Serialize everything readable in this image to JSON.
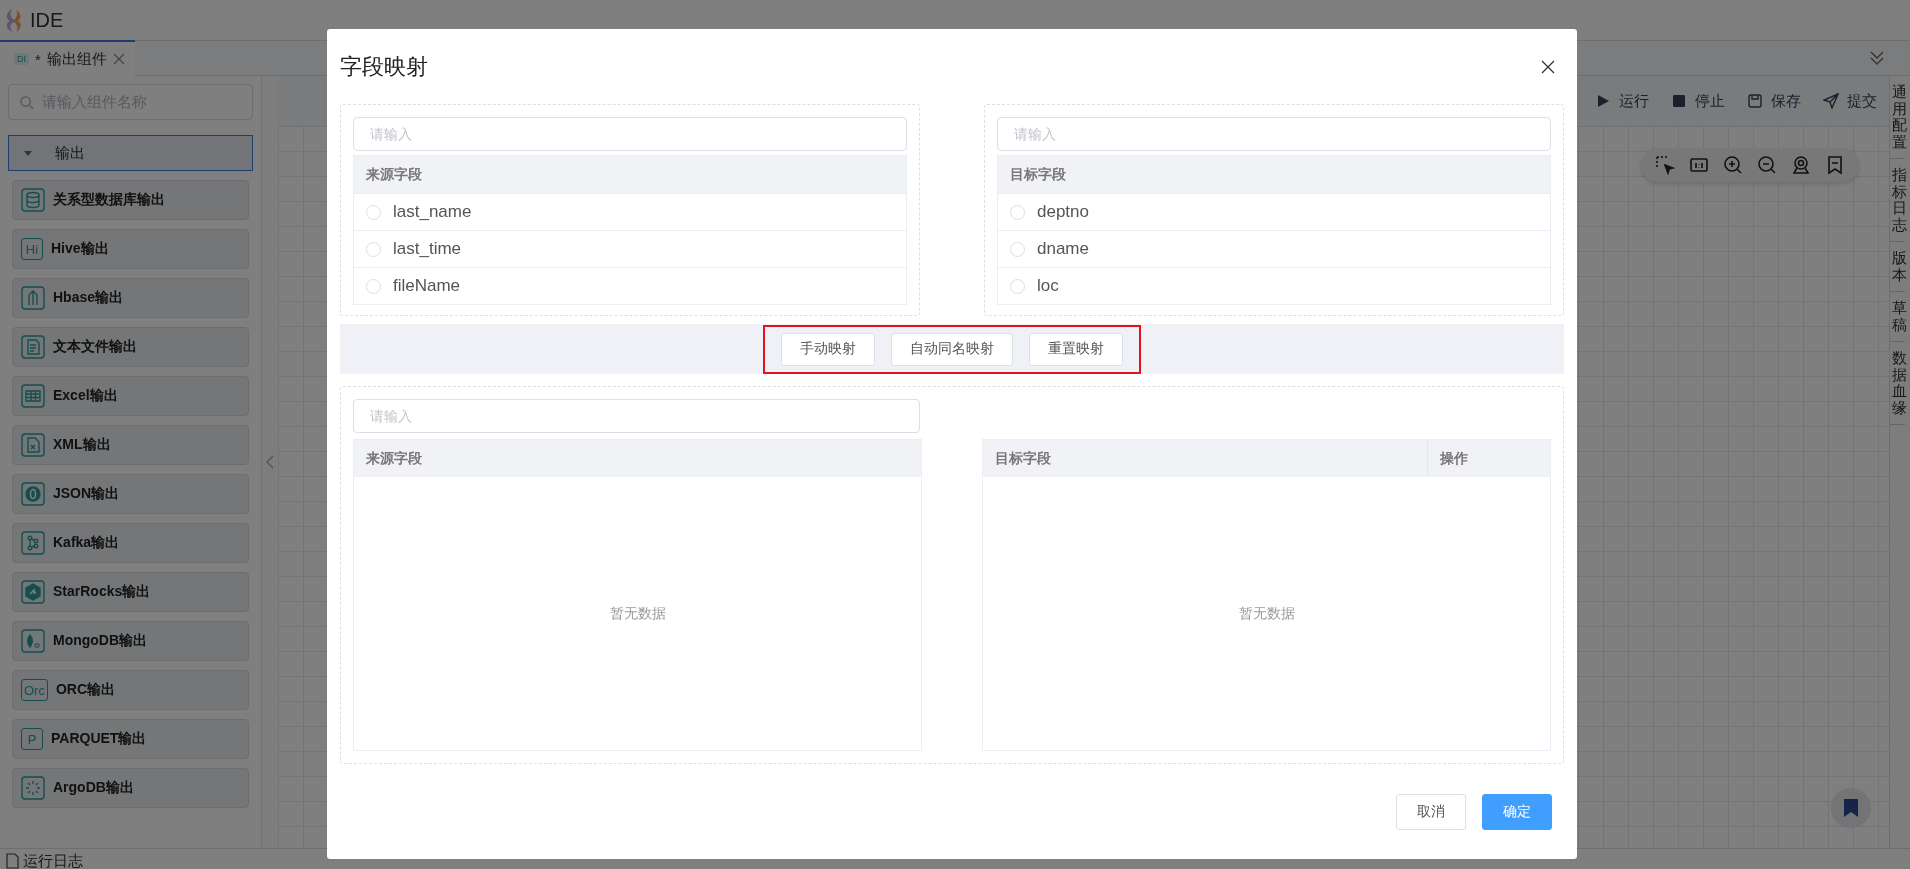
{
  "app": {
    "title": "IDE"
  },
  "tabs": [
    {
      "badge": "DI",
      "prefix": "*",
      "label": "输出组件",
      "selected": true
    }
  ],
  "sidebar": {
    "search_placeholder": "请输入组件名称",
    "group": {
      "label": "输出",
      "expanded": true,
      "items": [
        {
          "label": "关系型数据库输出",
          "kind": "database"
        },
        {
          "label": "Hive输出",
          "kind": "text",
          "icon_text": "Hi"
        },
        {
          "label": "Hbase输出",
          "kind": "hbase"
        },
        {
          "label": "文本文件输出",
          "kind": "file"
        },
        {
          "label": "Excel输出",
          "kind": "table"
        },
        {
          "label": "XML输出",
          "kind": "xml"
        },
        {
          "label": "JSON输出",
          "kind": "json"
        },
        {
          "label": "Kafka输出",
          "kind": "kafka"
        },
        {
          "label": "StarRocks输出",
          "kind": "starrocks"
        },
        {
          "label": "MongoDB输出",
          "kind": "mongodb"
        },
        {
          "label": "ORC输出",
          "kind": "text",
          "icon_text": "Orc"
        },
        {
          "label": "PARQUET输出",
          "kind": "text",
          "icon_text": "P"
        },
        {
          "label": "ArgoDB输出",
          "kind": "argodb"
        }
      ]
    }
  },
  "toolbar": [
    {
      "label": "运行",
      "kind": "run"
    },
    {
      "label": "停止",
      "kind": "stop"
    },
    {
      "label": "保存",
      "kind": "save"
    },
    {
      "label": "提交",
      "kind": "submit"
    }
  ],
  "side_tabs": [
    {
      "label": "通用配置"
    },
    {
      "label": "指标日志"
    },
    {
      "label": "版本"
    },
    {
      "label": "草稿"
    },
    {
      "label": "数据血缘"
    }
  ],
  "bottom_bar": {
    "label": "运行日志"
  },
  "dialog": {
    "title": "字段映射",
    "source_list": {
      "placeholder": "请输入",
      "header": "来源字段",
      "fields": [
        {
          "name": "last_name",
          "selected": false
        },
        {
          "name": "last_time",
          "selected": false
        },
        {
          "name": "fileName",
          "selected": false
        }
      ]
    },
    "target_list": {
      "placeholder": "请输入",
      "header": "目标字段",
      "fields": [
        {
          "name": "deptno",
          "selected": false
        },
        {
          "name": "dname",
          "selected": false
        },
        {
          "name": "loc",
          "selected": false
        }
      ]
    },
    "actions_highlighted": true,
    "actions": [
      {
        "label": "手动映射"
      },
      {
        "label": "自动同名映射"
      },
      {
        "label": "重置映射"
      }
    ],
    "mapping": {
      "placeholder": "请输入",
      "source_table": {
        "columns": [
          "来源字段"
        ],
        "empty_text": "暂无数据"
      },
      "target_table": {
        "columns": [
          "目标字段",
          "操作"
        ],
        "empty_text": "暂无数据"
      }
    },
    "footer": [
      {
        "label": "取消",
        "kind": "default"
      },
      {
        "label": "确定",
        "kind": "primary"
      }
    ]
  }
}
